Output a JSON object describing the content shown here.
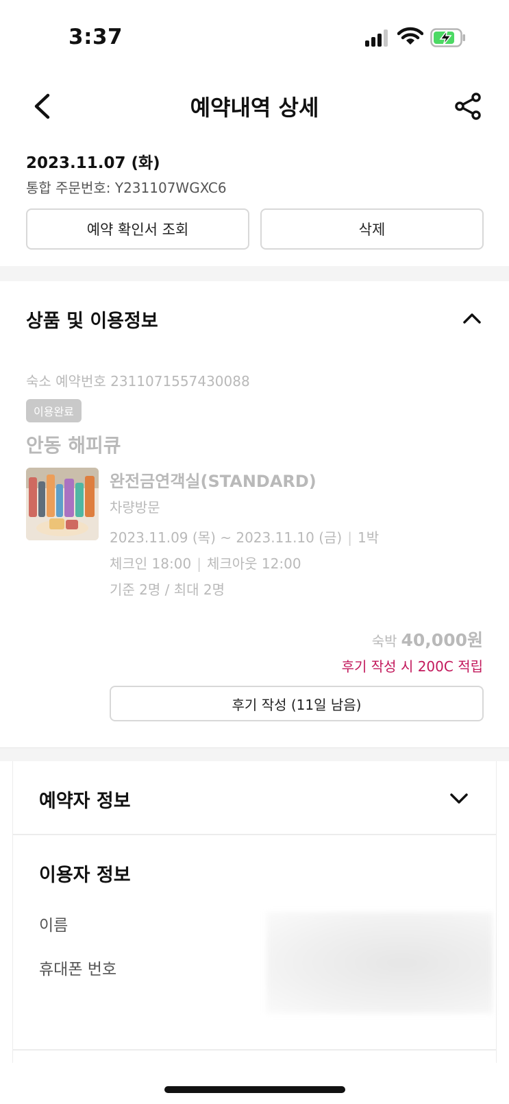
{
  "status_bar": {
    "time": "3:37"
  },
  "header": {
    "title": "예약내역 상세"
  },
  "order": {
    "date": "2023.11.07 (화)",
    "number_label": "통합 주문번호: Y231107WGXC6",
    "confirm_button": "예약 확인서 조회",
    "delete_button": "삭제"
  },
  "product_section": {
    "title": "상품 및 이용정보",
    "stay_number": "숙소 예약번호 2311071557430088",
    "status_badge": "이용완료",
    "hotel_name": "안동 해피큐",
    "room_name": "완전금연객실(STANDARD)",
    "visit_type": "차량방문",
    "check_in_date": "2023.11.09 (목)",
    "date_tilde": "~",
    "check_out_date": "2023.11.10 (금)",
    "nights": "1박",
    "check_in_time": "체크인 18:00",
    "check_out_time": "체크아웃 12:00",
    "capacity": "기준 2명 / 최대 2명",
    "price_label": "숙박",
    "price_amount": "40,000원",
    "review_reward": "후기 작성 시 200C 적립",
    "review_button": "후기 작성 (11일 남음)"
  },
  "booker_section": {
    "title": "예약자 정보"
  },
  "user_section": {
    "title": "이용자 정보",
    "name_label": "이름",
    "phone_label": "휴대폰 번호"
  },
  "colors": {
    "accent_reward": "#c2185b",
    "badge_bg": "#c9c9c9",
    "battery_charge": "#4cd964"
  }
}
